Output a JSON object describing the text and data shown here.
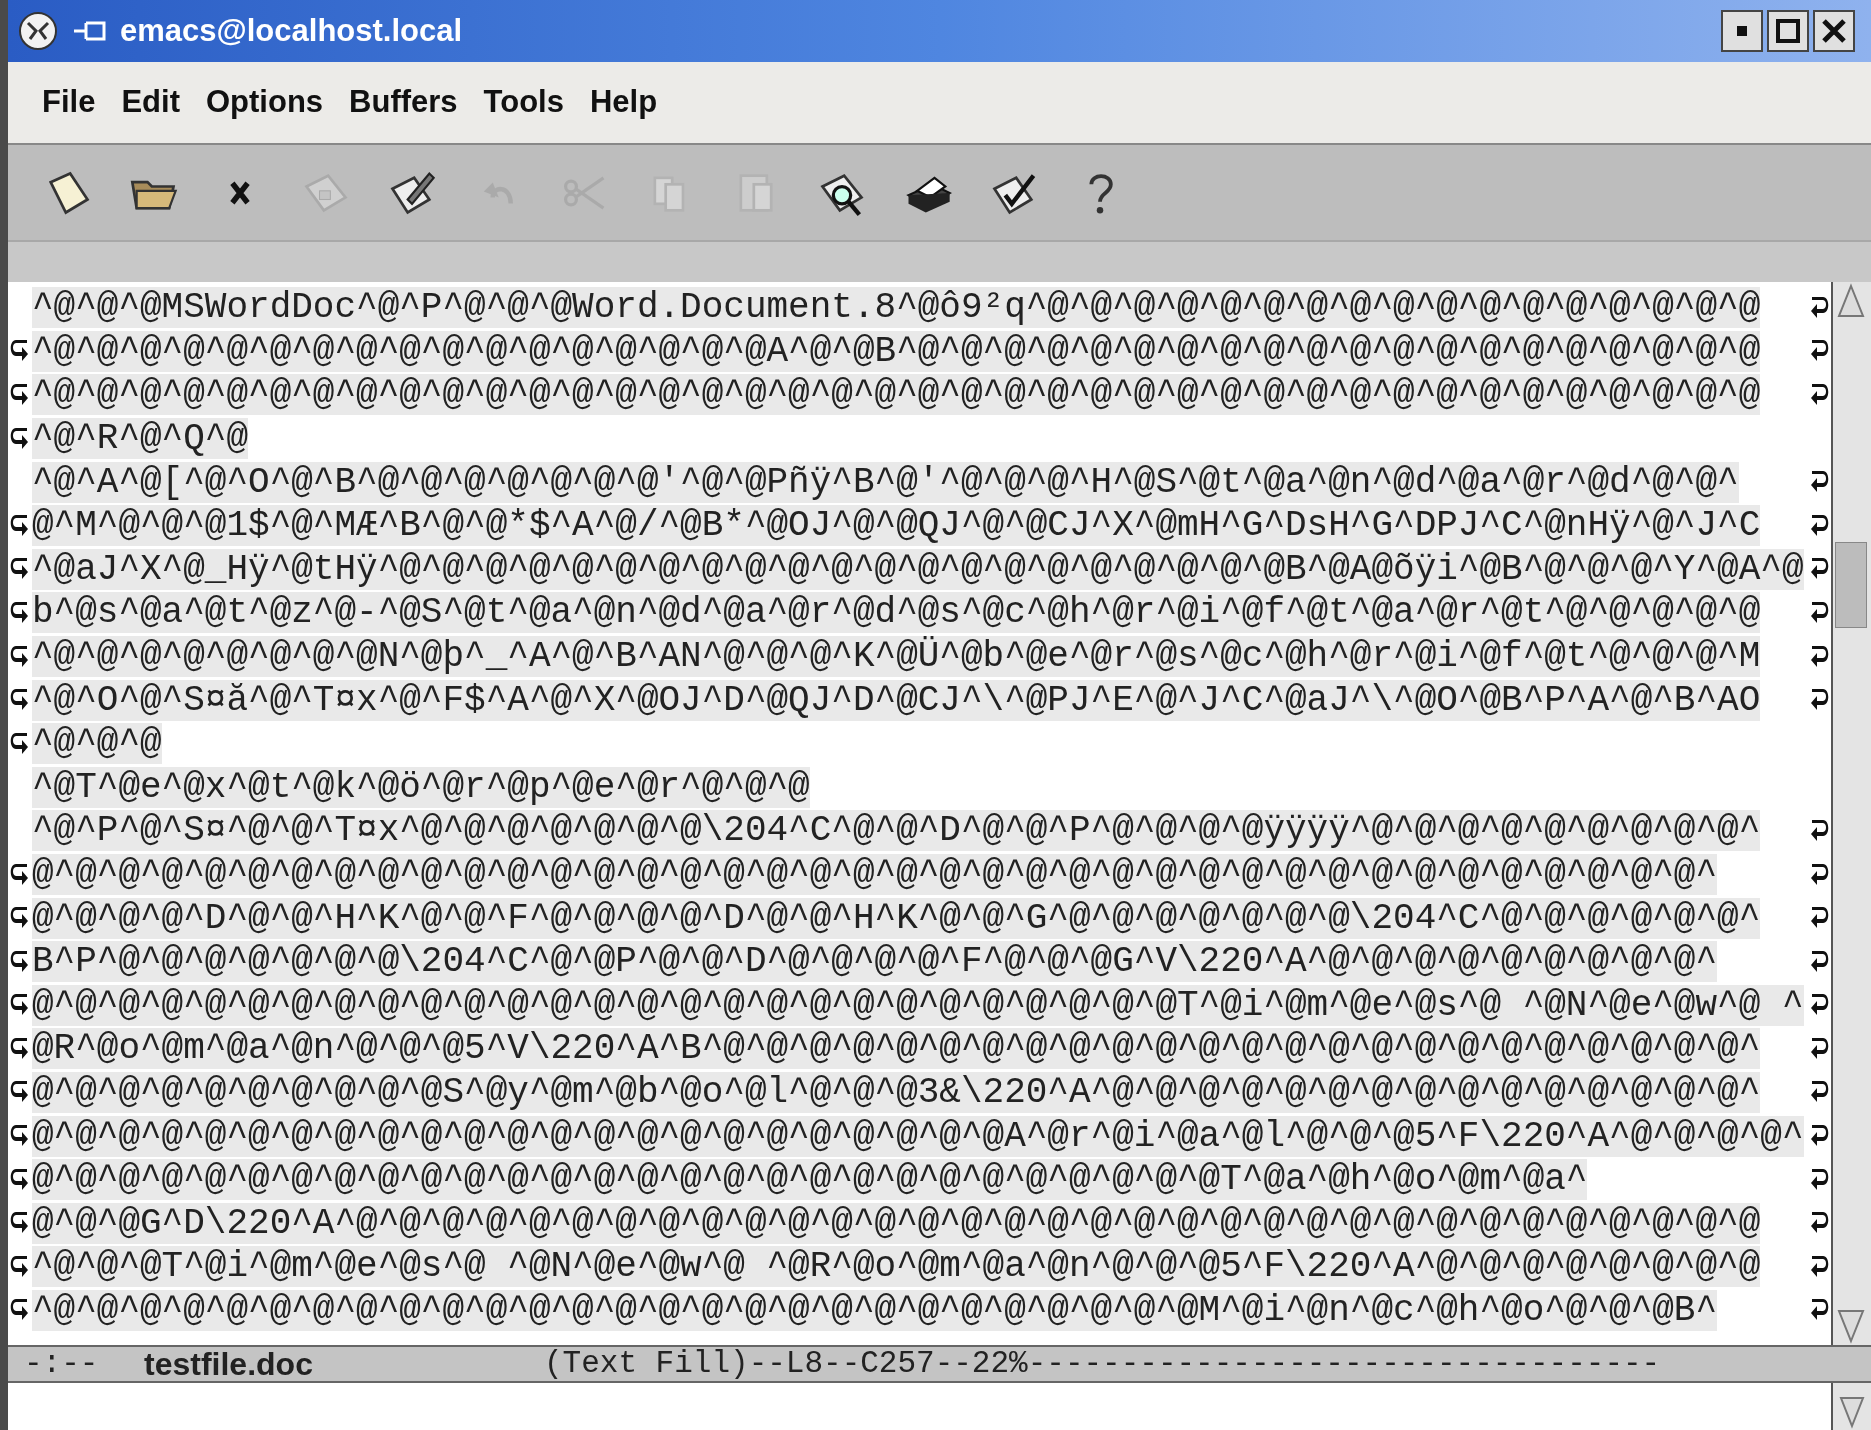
{
  "window": {
    "title": "emacs@localhost.local"
  },
  "menu": [
    {
      "label": "File"
    },
    {
      "label": "Edit"
    },
    {
      "label": "Options"
    },
    {
      "label": "Buffers"
    },
    {
      "label": "Tools"
    },
    {
      "label": "Help"
    }
  ],
  "toolbar": [
    {
      "disabled": false
    },
    {
      "disabled": false
    },
    {
      "disabled": false
    },
    {
      "disabled": true
    },
    {
      "disabled": false
    },
    {
      "disabled": true
    },
    {
      "disabled": true
    },
    {
      "disabled": true
    },
    {
      "disabled": true
    },
    {
      "disabled": false
    },
    {
      "disabled": false
    },
    {
      "disabled": false
    },
    {
      "disabled": false
    }
  ],
  "buffer_lines": [
    {
      "text": "^@^@^@MSWordDoc^@^P^@^@^@Word.Document.8^@ô9²q^@^@^@^@^@^@^@^@^@^@^@^@^@^@^@^@^@",
      "continued": false,
      "wrapped": true
    },
    {
      "text": "^@^@^@^@^@^@^@^@^@^@^@^@^@^@^@^@^@A^@^@B^@^@^@^@^@^@^@^@^@^@^@^@^@^@^@^@^@^@^@^@",
      "continued": true,
      "wrapped": true
    },
    {
      "text": "^@^@^@^@^@^@^@^@^@^@^@^@^@^@^@^@^@^@^@^@^@^@^@^@^@^@^@^@^@^@^@^@^@^@^@^@^@^@^@^@",
      "continued": true,
      "wrapped": true
    },
    {
      "text": "^@^R^@^Q^@",
      "continued": true,
      "wrapped": false
    },
    {
      "text": "^@^A^@[^@^O^@^B^@^@^@^@^@^@^@'^@^@Pñÿ^B^@'^@^@^@^H^@S^@t^@a^@n^@d^@a^@r^@d^@^@^",
      "continued": false,
      "wrapped": true
    },
    {
      "text": "@^M^@^@^@1$^@^MÆ^B^@^@*$^A^@/^@B*^@OJ^@^@QJ^@^@CJ^X^@mH^G^DsH^G^DPJ^C^@nHÿ^@^J^C",
      "continued": true,
      "wrapped": true
    },
    {
      "text": "^@aJ^X^@_Hÿ^@tHÿ^@^@^@^@^@^@^@^@^@^@^@^@^@^@^@^@^@^@^@^@^@B^@A@õÿi^@B^@^@^@^Y^@A^@",
      "continued": true,
      "wrapped": true
    },
    {
      "text": "b^@s^@a^@t^@z^@-^@S^@t^@a^@n^@d^@a^@r^@d^@s^@c^@h^@r^@i^@f^@t^@a^@r^@t^@^@^@^@^@",
      "continued": true,
      "wrapped": true
    },
    {
      "text": "^@^@^@^@^@^@^@^@N^@þ^_^A^@^B^AN^@^@^@^K^@Ü^@b^@e^@r^@s^@c^@h^@r^@i^@f^@t^@^@^@^M",
      "continued": true,
      "wrapped": true
    },
    {
      "text": "^@^O^@^S¤ă^@^T¤x^@^F$^A^@^X^@OJ^D^@QJ^D^@CJ^\\^@PJ^E^@^J^C^@aJ^\\^@O^@B^P^A^@^B^AO",
      "continued": true,
      "wrapped": true
    },
    {
      "text": "^@^@^@",
      "continued": true,
      "wrapped": false
    },
    {
      "text": "^@T^@e^@x^@t^@k^@ö^@r^@p^@e^@r^@^@^@",
      "continued": false,
      "wrapped": false
    },
    {
      "text": "^@^P^@^S¤^@^@^T¤x^@^@^@^@^@^@^@\\204^C^@^@^D^@^@^P^@^@^@^@ÿÿÿÿ^@^@^@^@^@^@^@^@^@^",
      "continued": false,
      "wrapped": true
    },
    {
      "text": "@^@^@^@^@^@^@^@^@^@^@^@^@^@^@^@^@^@^@^@^@^@^@^@^@^@^@^@^@^@^@^@^@^@^@^@^@^@^@^",
      "continued": true,
      "wrapped": true
    },
    {
      "text": "@^@^@^@^D^@^@^H^K^@^@^F^@^@^@^@^D^@^@^H^K^@^@^G^@^@^@^@^@^@^@\\204^C^@^@^@^@^@^@^",
      "continued": true,
      "wrapped": true
    },
    {
      "text": "B^P^@^@^@^@^@^@^@\\204^C^@^@P^@^@^D^@^@^@^@^F^@^@^@G^V\\220^A^@^@^@^@^@^@^@^@^@^",
      "continued": true,
      "wrapped": true
    },
    {
      "text": "@^@^@^@^@^@^@^@^@^@^@^@^@^@^@^@^@^@^@^@^@^@^@^@^@^@^@T^@i^@m^@e^@s^@ ^@N^@e^@w^@ ^",
      "continued": true,
      "wrapped": true
    },
    {
      "text": "@R^@o^@m^@a^@n^@^@^@5^V\\220^A^B^@^@^@^@^@^@^@^@^@^@^@^@^@^@^@^@^@^@^@^@^@^@^@^@^",
      "continued": true,
      "wrapped": true
    },
    {
      "text": "@^@^@^@^@^@^@^@^@^@S^@y^@m^@b^@o^@l^@^@^@3&\\220^A^@^@^@^@^@^@^@^@^@^@^@^@^@^@^@^",
      "continued": true,
      "wrapped": true
    },
    {
      "text": "@^@^@^@^@^@^@^@^@^@^@^@^@^@^@^@^@^@^@^@^@^@^@A^@r^@i^@a^@l^@^@^@5^F\\220^A^@^@^@^@^",
      "continued": true,
      "wrapped": true
    },
    {
      "text": "@^@^@^@^@^@^@^@^@^@^@^@^@^@^@^@^@^@^@^@^@^@^@^@^@^@^@^@T^@a^@h^@o^@m^@a^",
      "continued": true,
      "wrapped": true
    },
    {
      "text": "@^@^@G^D\\220^A^@^@^@^@^@^@^@^@^@^@^@^@^@^@^@^@^@^@^@^@^@^@^@^@^@^@^@^@^@^@^@^@^@",
      "continued": true,
      "wrapped": true
    },
    {
      "text": "^@^@^@T^@i^@m^@e^@s^@ ^@N^@e^@w^@ ^@R^@o^@m^@a^@n^@^@^@5^F\\220^A^@^@^@^@^@^@^@^@",
      "continued": true,
      "wrapped": true
    },
    {
      "text": "^@^@^@^@^@^@^@^@^@^@^@^@^@^@^@^@^@^@^@^@^@^@^@^@^@^@^@M^@i^@n^@c^@h^@o^@^@^@B^",
      "continued": true,
      "wrapped": true
    }
  ],
  "mode_line": {
    "status": "-:--",
    "buffer": "testfile.doc",
    "info": "(Text Fill)--L8--C257--22%",
    "fill": "----------------------------------"
  }
}
